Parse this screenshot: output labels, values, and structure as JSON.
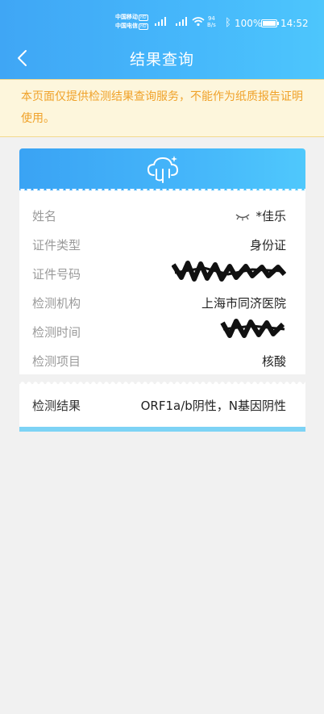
{
  "status_bar": {
    "carrier1": "中国移动",
    "carrier2": "中国电信",
    "hd": "HD",
    "net_speed_value": "94",
    "net_speed_unit": "B/s",
    "battery": "100%",
    "time": "14:52"
  },
  "header": {
    "title": "结果查询"
  },
  "notice": "本页面仅提供检测结果查询服务，不能作为纸质报告证明使用。",
  "details": [
    {
      "label": "姓名",
      "value": "*佳乐"
    },
    {
      "label": "证件类型",
      "value": "身份证"
    },
    {
      "label": "证件号码",
      "value": ""
    },
    {
      "label": "检测机构",
      "value": "上海市同济医院"
    },
    {
      "label": "检测时间",
      "value": ""
    },
    {
      "label": "检测项目",
      "value": "核酸"
    }
  ],
  "result": {
    "label": "检测结果",
    "value": "ORF1a/b阴性，N基因阴性"
  },
  "colors": {
    "header_blue": "#45b6fa",
    "notice_text": "#f0a22a",
    "notice_bg": "#fdf6dc"
  },
  "icons": [
    "back-arrow-icon",
    "cloud-check-icon",
    "eye-closed-icon",
    "wifi-icon",
    "bluetooth-icon",
    "battery-icon"
  ]
}
